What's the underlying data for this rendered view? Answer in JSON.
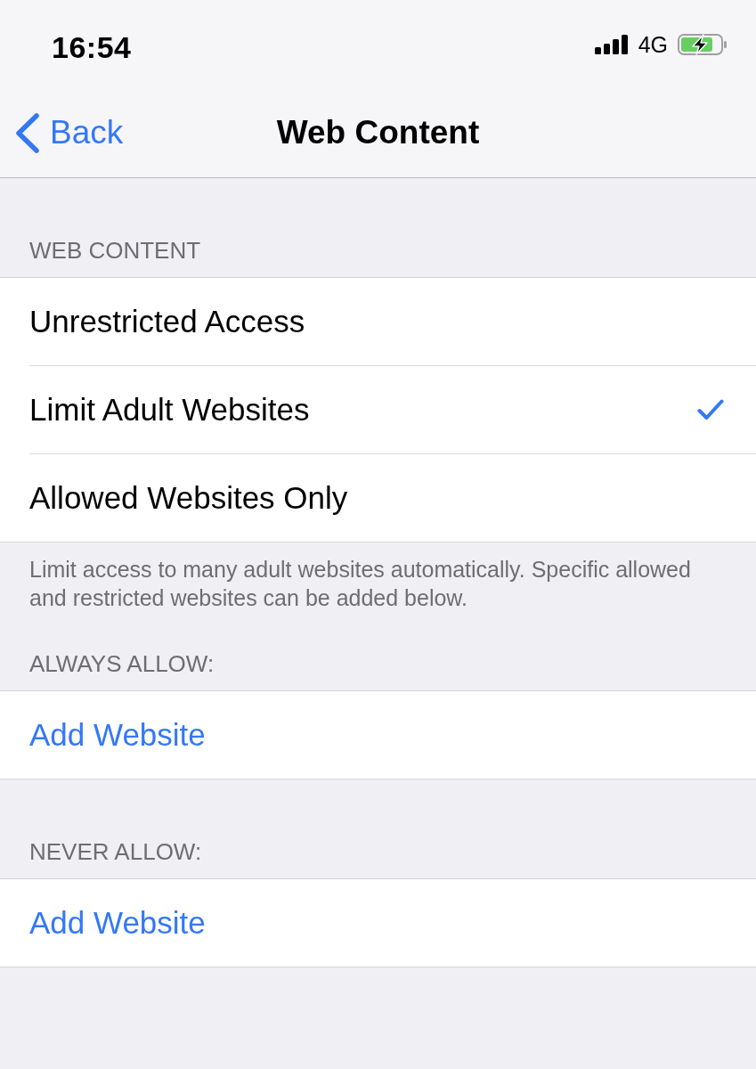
{
  "status_bar": {
    "time": "16:54",
    "network": "4G",
    "charging": true
  },
  "nav_bar": {
    "back": {
      "label": "Back"
    },
    "title": "Web Content"
  },
  "sections": [
    {
      "header": "WEB CONTENT",
      "items": [
        {
          "kind": "option",
          "label": "Unrestricted Access",
          "selected": false
        },
        {
          "kind": "option",
          "label": "Limit Adult Websites",
          "selected": true
        },
        {
          "kind": "option",
          "label": "Allowed Websites Only",
          "selected": false
        }
      ],
      "footer": "Limit access to many adult websites automatically. Specific allowed and restricted websites can be added below."
    },
    {
      "header": "ALWAYS ALLOW:",
      "items": [
        {
          "kind": "action",
          "label": "Add Website"
        }
      ]
    },
    {
      "header": "NEVER ALLOW:",
      "items": [
        {
          "kind": "action",
          "label": "Add Website"
        }
      ]
    }
  ]
}
